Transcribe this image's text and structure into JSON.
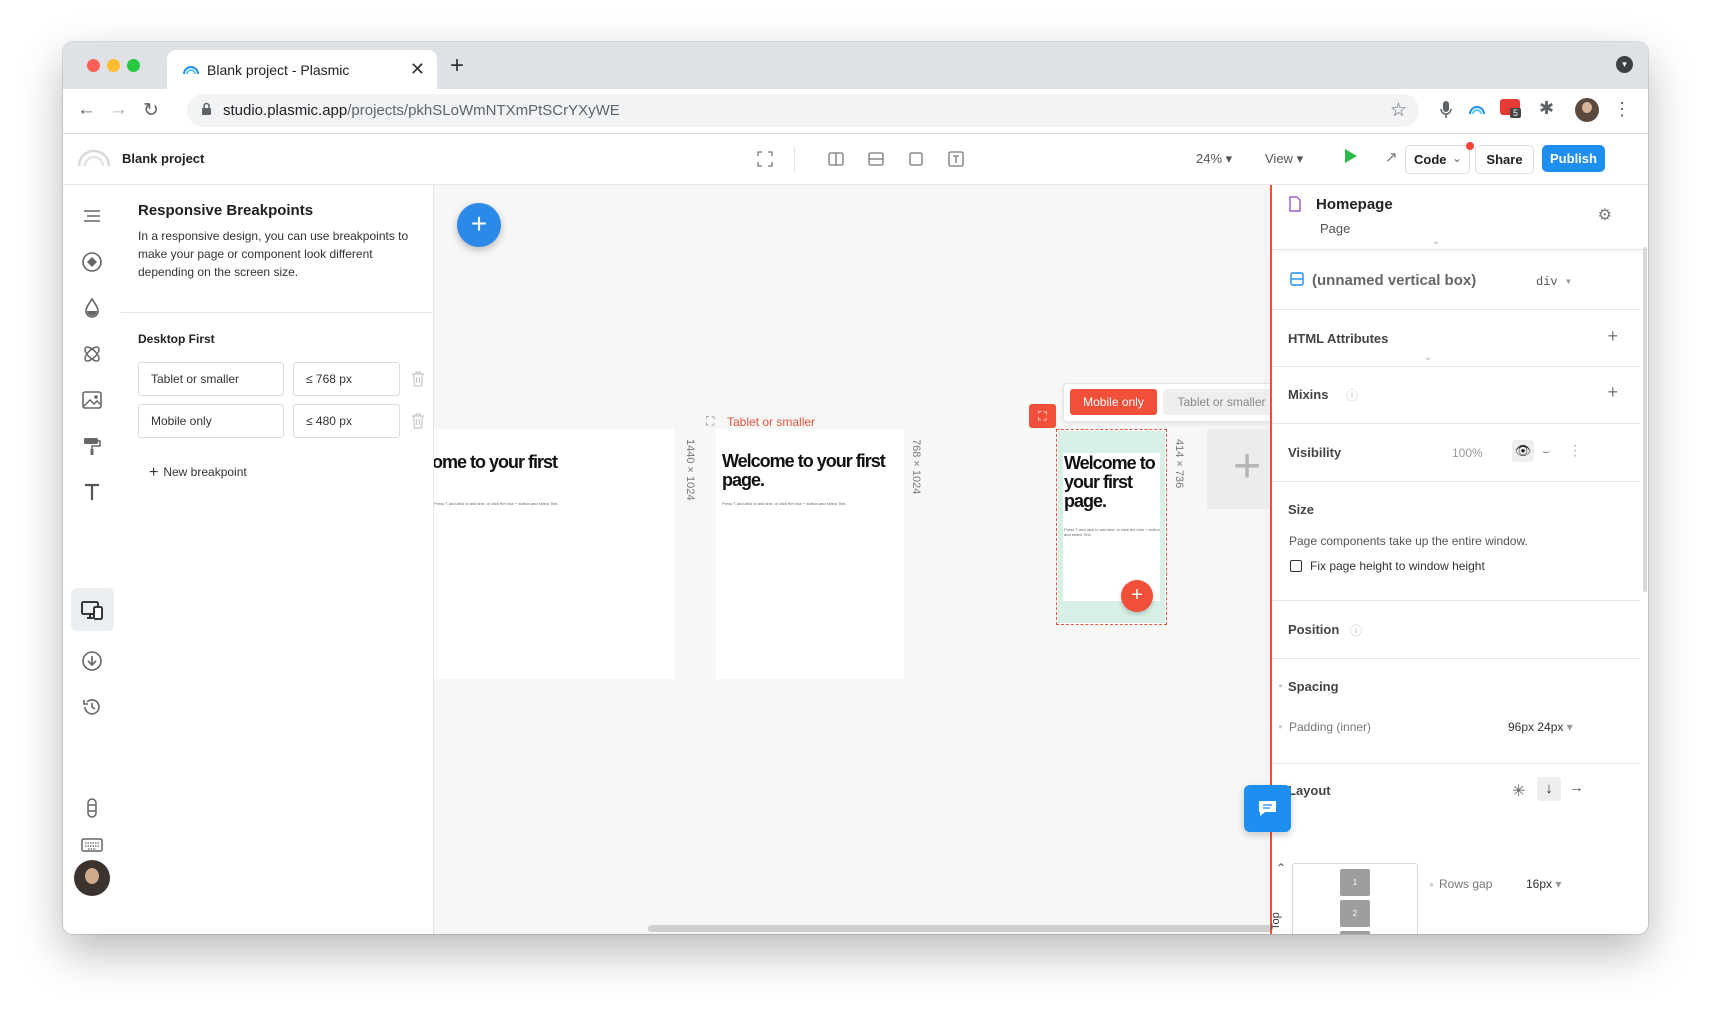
{
  "browser": {
    "tab_title": "Blank project - Plasmic",
    "url_host": "studio.plasmic.app",
    "url_path": "/projects/pkhSLoWmNTXmPtSCrYXyWE",
    "extension_badge": "5"
  },
  "topbar": {
    "project_name": "Blank project",
    "zoom": "24%",
    "view_label": "View",
    "code_label": "Code",
    "share_label": "Share",
    "publish_label": "Publish"
  },
  "breakpoints_panel": {
    "title": "Responsive Breakpoints",
    "description": "In a responsive design, you can use breakpoints to make your page or component look different depending on the screen size.",
    "group_label": "Desktop First",
    "breakpoints": [
      {
        "name": "Tablet or smaller",
        "max_width": "≤ 768 px"
      },
      {
        "name": "Mobile only",
        "max_width": "≤ 480 px"
      }
    ],
    "new_label": "New breakpoint"
  },
  "canvas": {
    "frames": [
      {
        "heading": "ome to your first",
        "dims": "1440 × 1024"
      },
      {
        "heading": "Welcome to your first page.",
        "dims": "768 × 1024",
        "label": "Tablet or smaller"
      },
      {
        "heading": "Welcome to your first page.",
        "dims": "414 × 736"
      }
    ],
    "body_text": "Press T and click to add text, or click the blue + button and select Text.",
    "bp_tab_active": "Mobile only",
    "bp_tab_inactive": "Tablet or smaller"
  },
  "right_panel": {
    "title": "Homepage",
    "subtitle": "Page",
    "element_name": "(unnamed vertical box)",
    "element_tag": "div",
    "sections": {
      "html_attributes": "HTML Attributes",
      "mixins": "Mixins",
      "visibility": "Visibility",
      "visibility_value": "100%",
      "size": "Size",
      "size_note": "Page components take up the entire window.",
      "fix_height": "Fix page height to window height",
      "position": "Position",
      "spacing": "Spacing",
      "padding_label": "Padding (inner)",
      "padding_value": "96px 24px",
      "layout": "Layout",
      "rows_gap_label": "Rows gap",
      "rows_gap_value": "16px",
      "top_label": "Top"
    }
  },
  "colors": {
    "accent_blue": "#1f8ef1",
    "accent_red": "#f0503a",
    "play_green": "#2db84c"
  }
}
